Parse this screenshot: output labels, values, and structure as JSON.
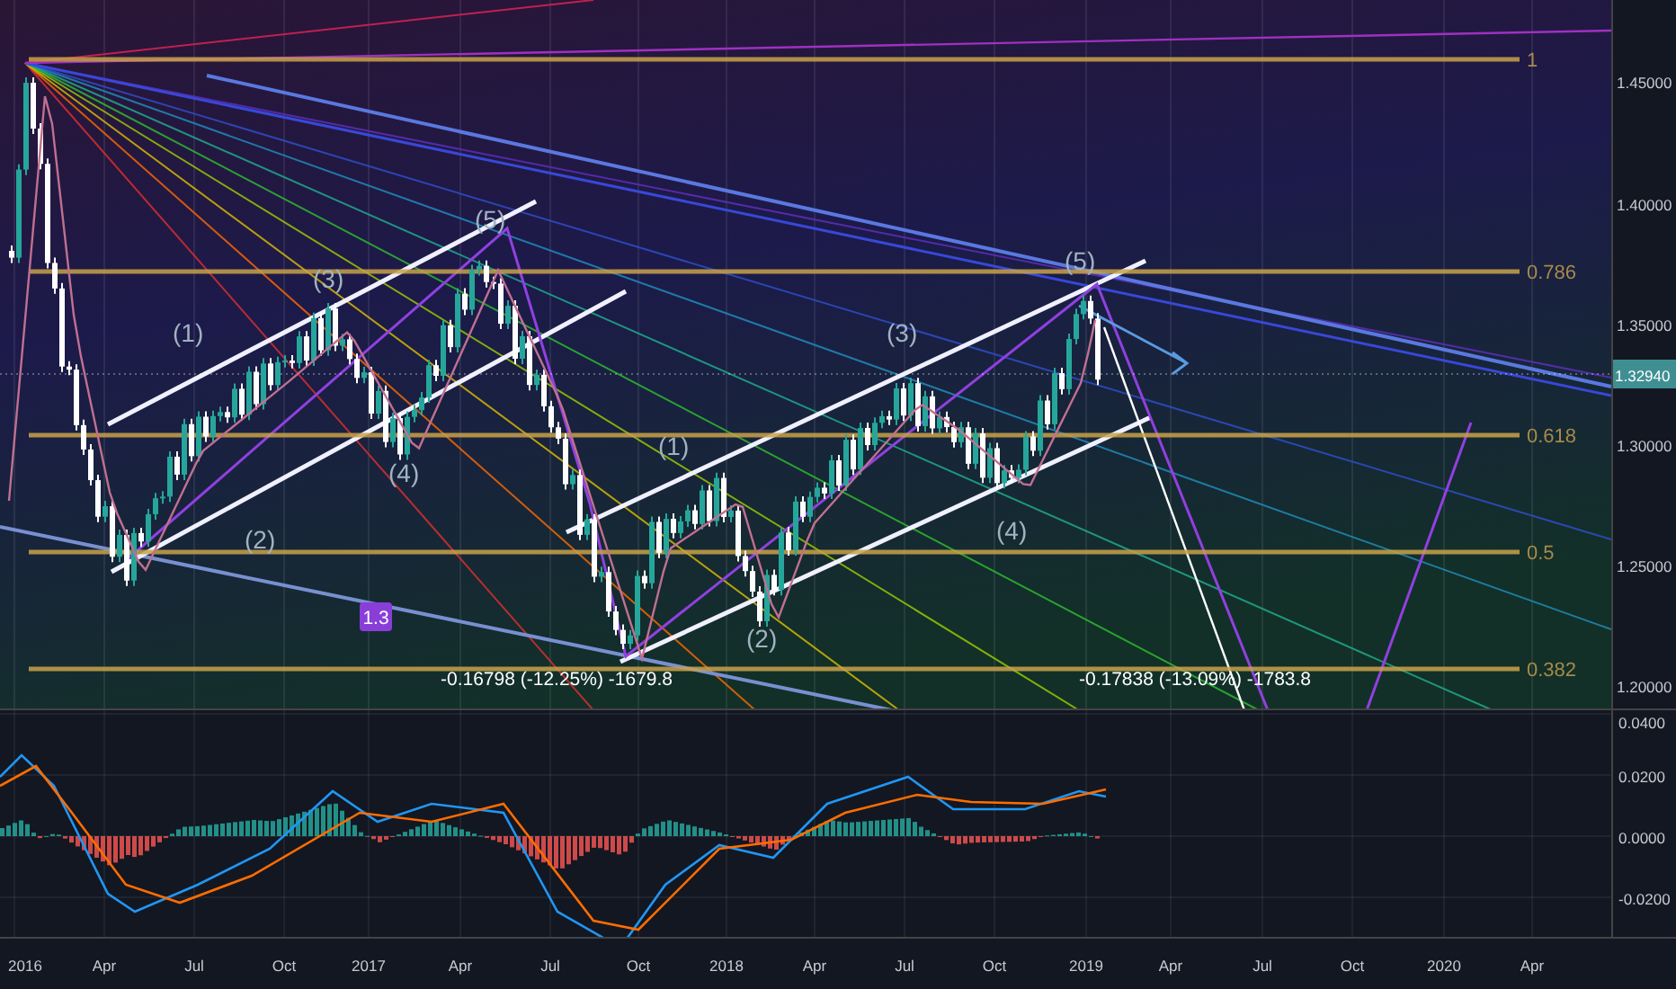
{
  "price_chart": {
    "fib_levels": [
      {
        "label": "1"
      },
      {
        "label": "0.786"
      },
      {
        "label": "0.618"
      },
      {
        "label": "0.5"
      },
      {
        "label": "0.382"
      }
    ],
    "wave_labels": [
      "(1)",
      "(2)",
      "(3)",
      "(4)",
      "(5)",
      "(1)",
      "(2)",
      "(3)",
      "(4)",
      "(5)"
    ],
    "measurements": [
      "-0.16798 (-12.25%) -1679.8",
      "-0.17838 (-13.09%) -1783.8"
    ],
    "badge": "1.3",
    "price_axis": {
      "ticks": [
        "1.45000",
        "1.40000",
        "1.35000",
        "1.30000",
        "1.25000",
        "1.20000"
      ],
      "current_price": "1.32940"
    }
  },
  "macd": {
    "axis_ticks": [
      "0.0400",
      "0.0200",
      "0.0000",
      "-0.0200"
    ]
  },
  "time_axis": {
    "labels": [
      "2016",
      "Apr",
      "Jul",
      "Oct",
      "2017",
      "Apr",
      "Jul",
      "Oct",
      "2018",
      "Apr",
      "Jul",
      "Oct",
      "2019",
      "Apr",
      "Jul",
      "Oct",
      "2020",
      "Apr"
    ]
  }
}
